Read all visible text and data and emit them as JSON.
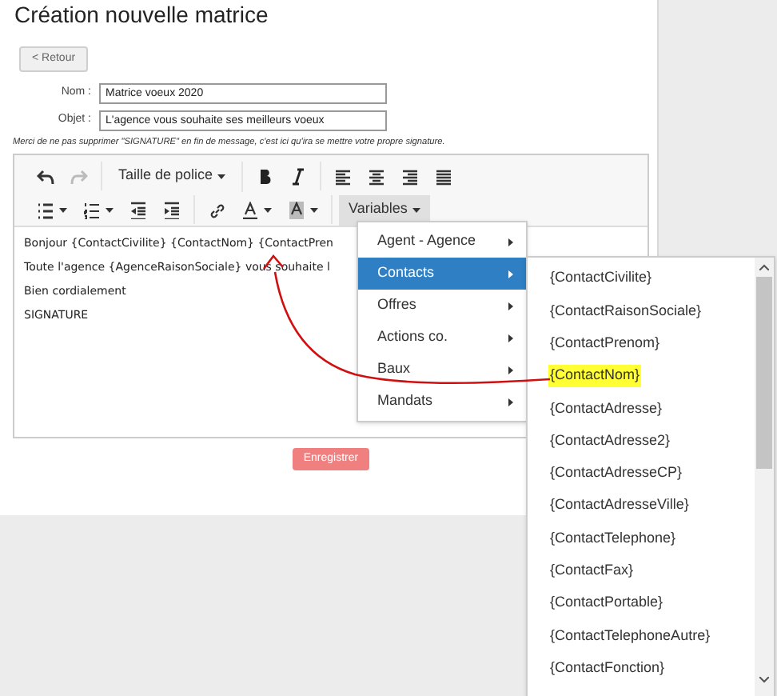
{
  "page": {
    "title": "Création nouvelle matrice",
    "back_button": "< Retour"
  },
  "form": {
    "fields": [
      {
        "label": "Nom :",
        "value": "Matrice voeux 2020"
      },
      {
        "label": "Objet :",
        "value": "L'agence vous souhaite ses meilleurs voeux"
      }
    ],
    "note": "Merci de ne pas supprimer \"SIGNATURE\" en fin de message, c'est ici qu'ira se mettre votre propre signature."
  },
  "toolbar": {
    "rows": [
      [
        [
          {
            "kind": "undo",
            "disabled": false
          },
          {
            "kind": "redo",
            "disabled": true
          }
        ],
        [
          {
            "kind": "dropdown",
            "label": "Taille de police",
            "active": false
          }
        ],
        [
          {
            "kind": "bold",
            "disabled": false
          },
          {
            "kind": "italic",
            "disabled": false
          }
        ],
        [
          {
            "kind": "alignleft",
            "disabled": false
          },
          {
            "kind": "aligncenter",
            "disabled": false
          },
          {
            "kind": "alignright",
            "disabled": false
          },
          {
            "kind": "justify",
            "disabled": false
          }
        ]
      ],
      [
        [
          {
            "kind": "bullets",
            "disabled": false
          },
          {
            "kind": "numbers",
            "disabled": false
          },
          {
            "kind": "outdent",
            "disabled": false
          },
          {
            "kind": "indent",
            "disabled": false
          }
        ],
        [
          {
            "kind": "link",
            "disabled": false
          },
          {
            "kind": "textcolor",
            "disabled": false
          },
          {
            "kind": "backcolor",
            "disabled": false
          }
        ],
        [
          {
            "kind": "dropdown",
            "label": "Variables",
            "active": true
          }
        ]
      ]
    ]
  },
  "editor": {
    "lines": [
      "Bonjour {ContactCivilite} {ContactNom} {ContactPren",
      "Toute l'agence {AgenceRaisonSociale} vous souhaite l",
      "Bien cordialement",
      "SIGNATURE"
    ]
  },
  "save_button": "Enregistrer",
  "menu": {
    "items": [
      {
        "label": "Agent - Agence",
        "selected": false
      },
      {
        "label": "Contacts",
        "selected": true
      },
      {
        "label": "Offres",
        "selected": false
      },
      {
        "label": "Actions co.",
        "selected": false
      },
      {
        "label": "Baux",
        "selected": false
      },
      {
        "label": "Mandats",
        "selected": false
      }
    ]
  },
  "submenu": {
    "items": [
      {
        "label": "{ContactCivilite}",
        "highlighted": false
      },
      {
        "label": "{ContactRaisonSociale}",
        "highlighted": false
      },
      {
        "label": "{ContactPrenom}",
        "highlighted": false
      },
      {
        "label": "{ContactNom}",
        "highlighted": true
      },
      {
        "label": "{ContactAdresse}",
        "highlighted": false
      },
      {
        "label": "{ContactAdresse2}",
        "highlighted": false
      },
      {
        "label": "{ContactAdresseCP}",
        "highlighted": false
      },
      {
        "label": "{ContactAdresseVille}",
        "highlighted": false
      },
      {
        "label": "{ContactTelephone}",
        "highlighted": false
      },
      {
        "label": "{ContactFax}",
        "highlighted": false
      },
      {
        "label": "{ContactPortable}",
        "highlighted": false
      },
      {
        "label": "{ContactTelephoneAutre}",
        "highlighted": false
      },
      {
        "label": "{ContactFonction}",
        "highlighted": false
      }
    ]
  }
}
